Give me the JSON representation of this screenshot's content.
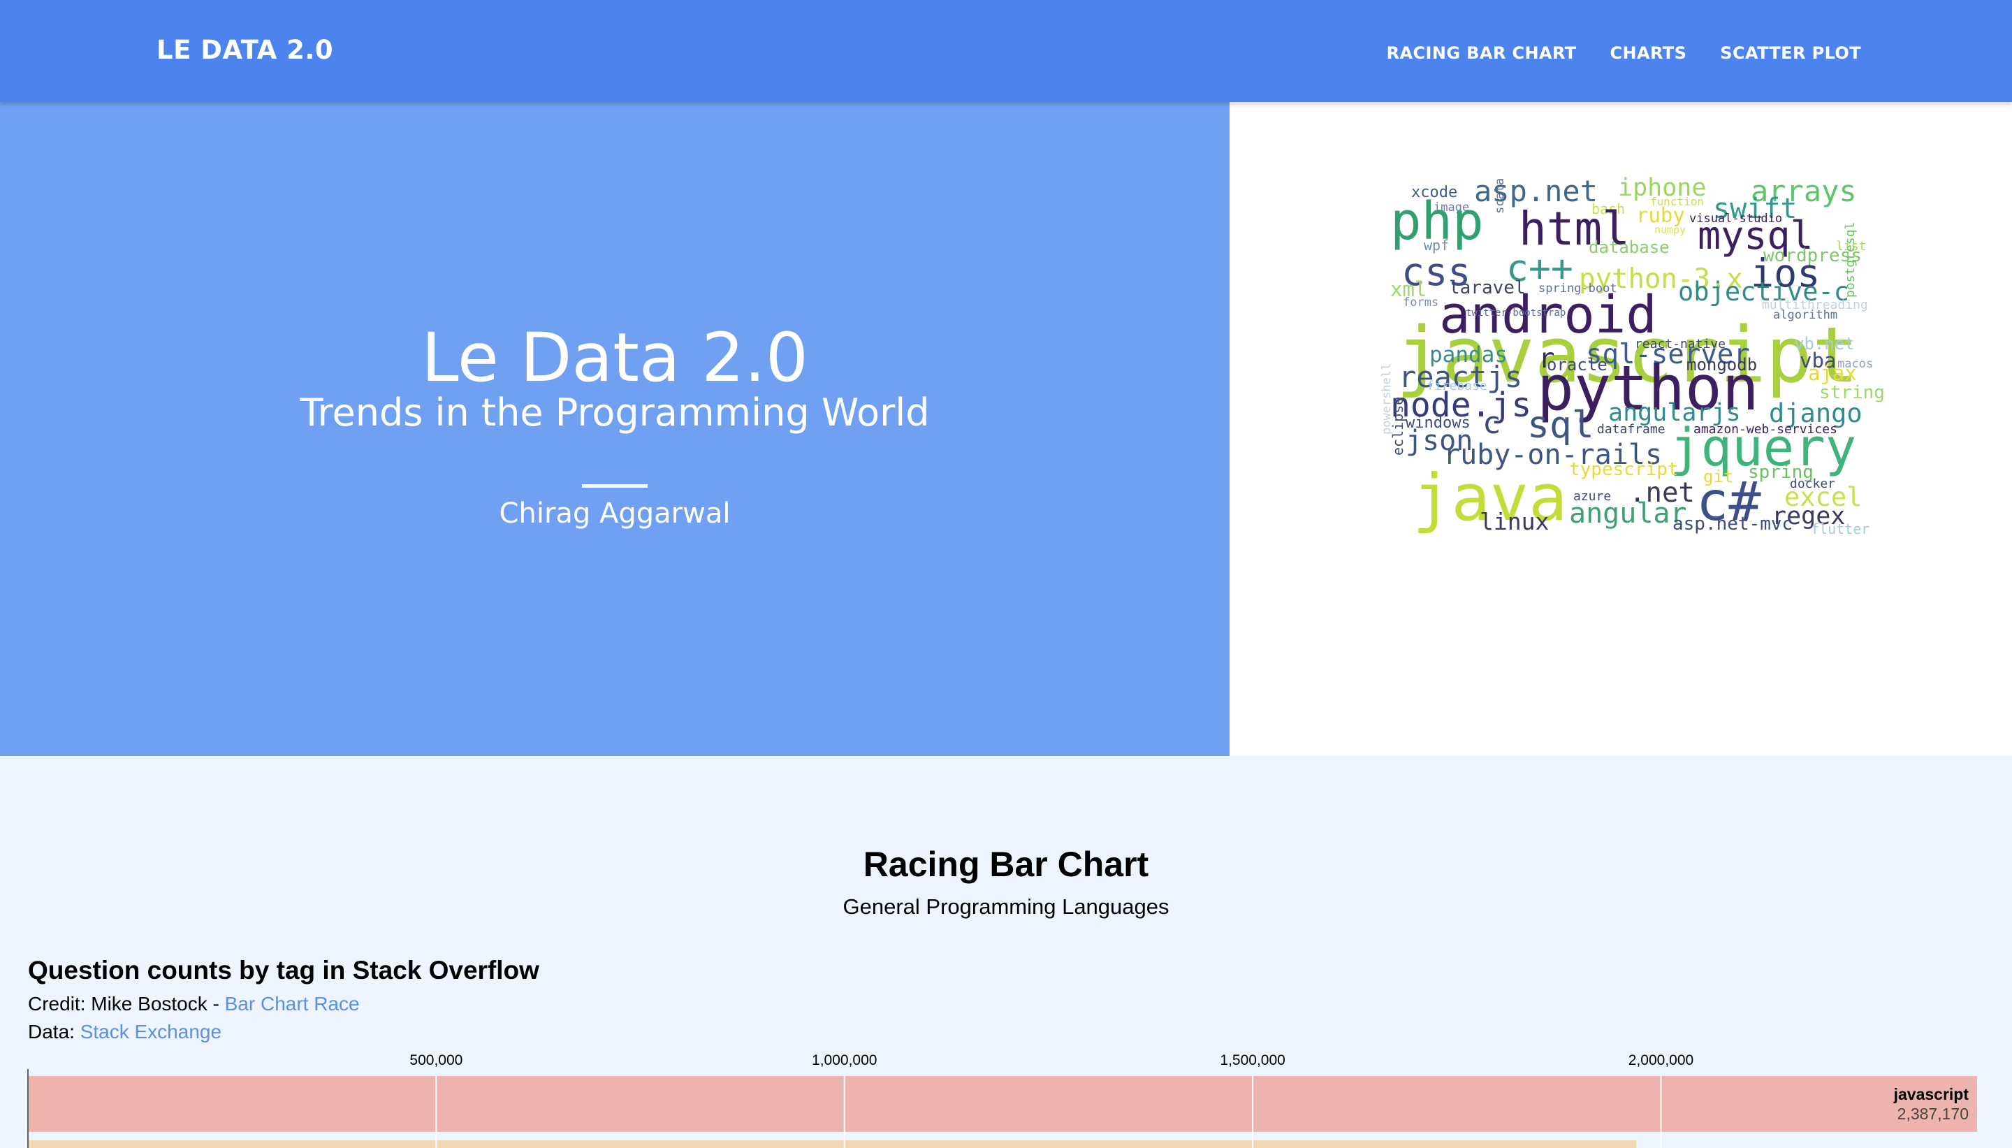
{
  "nav": {
    "brand": "LE DATA 2.0",
    "links": [
      "RACING BAR CHART",
      "CHARTS",
      "SCATTER PLOT"
    ]
  },
  "hero": {
    "title": "Le Data 2.0",
    "subtitle": "Trends in the Programming World",
    "author": "Chirag Aggarwal"
  },
  "wordcloud": {
    "words": [
      {
        "text": "xcode",
        "x": 106,
        "y": 130,
        "size": 24,
        "color": "#3c5b8f",
        "rotate": 0
      },
      {
        "text": "asp.net",
        "x": 153,
        "y": 140,
        "size": 46,
        "color": "#3e698d",
        "rotate": 0
      },
      {
        "text": "iphone",
        "x": 268,
        "y": 133,
        "size": 38,
        "color": "#9ad65e",
        "rotate": 0
      },
      {
        "text": "arrays",
        "x": 362,
        "y": 138,
        "size": 46,
        "color": "#5ec668",
        "rotate": 0
      },
      {
        "text": "image",
        "x": 150,
        "y": 168,
        "size": 18,
        "color": "#6b7fa8",
        "rotate": 0
      },
      {
        "text": "bash",
        "x": 244,
        "y": 168,
        "size": 22,
        "color": "#c8e14a",
        "rotate": 0
      },
      {
        "text": "function",
        "x": 290,
        "y": 160,
        "size": 17,
        "color": "#c8e14a",
        "rotate": 0
      },
      {
        "text": "swift",
        "x": 340,
        "y": 176,
        "size": 44,
        "color": "#2f9a8c",
        "rotate": 0
      },
      {
        "text": "php",
        "x": 88,
        "y": 205,
        "size": 80,
        "color": "#32a06e",
        "rotate": 0
      },
      {
        "text": "html",
        "x": 186,
        "y": 208,
        "size": 72,
        "color": "#3b1f5e",
        "rotate": 0
      },
      {
        "text": "ruby",
        "x": 282,
        "y": 185,
        "size": 32,
        "color": "#e6d93a",
        "rotate": 0
      },
      {
        "text": "visual-studio",
        "x": 322,
        "y": 187,
        "size": 18,
        "color": "#3b1f5e",
        "rotate": 0
      },
      {
        "text": "scala",
        "x": 175,
        "y": 188,
        "size": 18,
        "color": "#5e6d9b",
        "rotate": 90
      },
      {
        "text": "mysql",
        "x": 326,
        "y": 210,
        "size": 60,
        "color": "#3b1f5e",
        "rotate": 0
      },
      {
        "text": "list",
        "x": 424,
        "y": 200,
        "size": 20,
        "color": "#a1db54",
        "rotate": 0
      },
      {
        "text": "numpy",
        "x": 285,
        "y": 203,
        "size": 16,
        "color": "#e0e14e",
        "rotate": 0
      },
      {
        "text": "wpf",
        "x": 116,
        "y": 216,
        "size": 22,
        "color": "#6b8fb0",
        "rotate": 0
      },
      {
        "text": "database",
        "x": 242,
        "y": 218,
        "size": 26,
        "color": "#8dcb6a",
        "rotate": 0
      },
      {
        "text": "c++",
        "x": 180,
        "y": 240,
        "size": 58,
        "color": "#36988a",
        "rotate": 0
      },
      {
        "text": "wordpress",
        "x": 380,
        "y": 228,
        "size": 28,
        "color": "#7fc66a",
        "rotate": 0
      },
      {
        "text": "css",
        "x": 96,
        "y": 245,
        "size": 60,
        "color": "#3e4f88",
        "rotate": 0
      },
      {
        "text": "python-3.x",
        "x": 238,
        "y": 248,
        "size": 42,
        "color": "#c6dd4a",
        "rotate": 0
      },
      {
        "text": "ios",
        "x": 370,
        "y": 258,
        "size": 60,
        "color": "#2e3a6e",
        "rotate": 0
      },
      {
        "text": "xml",
        "x": 88,
        "y": 262,
        "size": 32,
        "color": "#a0d964",
        "rotate": 0
      },
      {
        "text": "laravel",
        "x": 135,
        "y": 258,
        "size": 28,
        "color": "#3e4565",
        "rotate": 0
      },
      {
        "text": "spring-boot",
        "x": 203,
        "y": 258,
        "size": 18,
        "color": "#5e6d9b",
        "rotate": 0
      },
      {
        "text": "forms",
        "x": 97,
        "y": 272,
        "size": 18,
        "color": "#7c8db8",
        "rotate": 0
      },
      {
        "text": "android",
        "x": 125,
        "y": 292,
        "size": 80,
        "color": "#3b1f5e",
        "rotate": 0
      },
      {
        "text": "objective-c",
        "x": 314,
        "y": 276,
        "size": 40,
        "color": "#2f8c8a",
        "rotate": 0
      },
      {
        "text": "multithreading",
        "x": 362,
        "y": 290,
        "size": 20,
        "color": "#c4cfdd",
        "rotate": 0
      },
      {
        "text": "twitter-bootstrap",
        "x": 146,
        "y": 298,
        "size": 15,
        "color": "#5e6d9b",
        "rotate": 0
      },
      {
        "text": "algorithm",
        "x": 362,
        "y": 304,
        "size": 18,
        "color": "#5e6d9b",
        "rotate": 0
      },
      {
        "text": "javascript",
        "x": 92,
        "y": 388,
        "size": 120,
        "color": "#a7cf3e",
        "rotate": 0
      },
      {
        "text": "postgresql",
        "x": 444,
        "y": 292,
        "size": 20,
        "color": "#6bc15e",
        "rotate": 90
      },
      {
        "text": "react-native",
        "x": 280,
        "y": 342,
        "size": 20,
        "color": "#3b4565",
        "rotate": 0
      },
      {
        "text": "vb.net",
        "x": 384,
        "y": 346,
        "size": 26,
        "color": "#a4cbe6",
        "rotate": 0
      },
      {
        "text": "pandas",
        "x": 121,
        "y": 358,
        "size": 34,
        "color": "#398b8a",
        "rotate": 0
      },
      {
        "text": "r",
        "x": 205,
        "y": 370,
        "size": 42,
        "color": "#2e2b5e",
        "rotate": 0
      },
      {
        "text": "sql-server",
        "x": 240,
        "y": 362,
        "size": 42,
        "color": "#3c5b8f",
        "rotate": 0
      },
      {
        "text": "vba",
        "x": 385,
        "y": 370,
        "size": 32,
        "color": "#3e4a78",
        "rotate": 0
      },
      {
        "text": "macos",
        "x": 414,
        "y": 372,
        "size": 18,
        "color": "#8fa0c0",
        "rotate": 0
      },
      {
        "text": "mongodb",
        "x": 320,
        "y": 378,
        "size": 26,
        "color": "#3b3a5e",
        "rotate": 0
      },
      {
        "text": "reactjs",
        "x": 96,
        "y": 392,
        "size": 46,
        "color": "#3e5580",
        "rotate": 0
      },
      {
        "text": "oracle",
        "x": 210,
        "y": 386,
        "size": 26,
        "color": "#3e4a78",
        "rotate": 0
      },
      {
        "text": "python",
        "x": 205,
        "y": 420,
        "size": 96,
        "color": "#3b1f5e",
        "rotate": 0
      },
      {
        "text": "ajax",
        "x": 394,
        "y": 396,
        "size": 32,
        "color": "#e6d93a",
        "rotate": 0
      },
      {
        "text": "firebase",
        "x": 116,
        "y": 402,
        "size": 20,
        "color": "#a4cbe6",
        "rotate": 0
      },
      {
        "text": "string",
        "x": 398,
        "y": 418,
        "size": 28,
        "color": "#a0d964",
        "rotate": 0
      },
      {
        "text": "node.js",
        "x": 90,
        "y": 432,
        "size": 52,
        "color": "#353a7a",
        "rotate": 0
      },
      {
        "text": "windows",
        "x": 103,
        "y": 450,
        "size": 24,
        "color": "#3e4a78",
        "rotate": 0
      },
      {
        "text": "angularjs",
        "x": 263,
        "y": 440,
        "size": 38,
        "color": "#2f8c8a",
        "rotate": 0
      },
      {
        "text": "django",
        "x": 384,
        "y": 440,
        "size": 40,
        "color": "#2f8c8a",
        "rotate": 0
      },
      {
        "text": "c",
        "x": 158,
        "y": 464,
        "size": 48,
        "color": "#3e4a78",
        "rotate": 0
      },
      {
        "text": "sql",
        "x": 194,
        "y": 474,
        "size": 58,
        "color": "#3e5580",
        "rotate": 0
      },
      {
        "text": "dataframe",
        "x": 250,
        "y": 466,
        "size": 20,
        "color": "#3e4565",
        "rotate": 0
      },
      {
        "text": "amazon-web-services",
        "x": 324,
        "y": 462,
        "size": 20,
        "color": "#3b1f5e",
        "rotate": 0
      },
      {
        "text": "powershell",
        "x": 1090,
        "y": 0,
        "size": 18,
        "color": "#c4cfdd",
        "rotate": 90,
        "note": ""
      },
      {
        "text": "json",
        "x": 100,
        "y": 486,
        "size": 44,
        "color": "#3e5580",
        "rotate": 0
      },
      {
        "text": "jquery",
        "x": 308,
        "y": 508,
        "size": 80,
        "color": "#3fb37a",
        "rotate": 0
      },
      {
        "text": "ruby-on-rails",
        "x": 130,
        "y": 510,
        "size": 44,
        "color": "#3e5580",
        "rotate": 0
      },
      {
        "text": "typescript",
        "x": 228,
        "y": 526,
        "size": 28,
        "color": "#e6d93a",
        "rotate": 0
      },
      {
        "text": "spring",
        "x": 364,
        "y": 528,
        "size": 28,
        "color": "#6bc15e",
        "rotate": 0
      },
      {
        "text": "git",
        "x": 334,
        "y": 534,
        "size": 26,
        "color": "#e6d93a",
        "rotate": 0
      },
      {
        "text": "docker",
        "x": 393,
        "y": 548,
        "size": 20,
        "color": "#3e4a78",
        "rotate": 0
      },
      {
        "text": "java",
        "x": 108,
        "y": 588,
        "size": 100,
        "color": "#c4db3a",
        "rotate": 0
      },
      {
        "text": "eclipse",
        "x": 96,
        "y": 490,
        "size": 22,
        "color": "#3e4a78",
        "rotate": 90
      },
      {
        "text": ".net",
        "x": 276,
        "y": 564,
        "size": 42,
        "color": "#3b3a5e",
        "rotate": 0
      },
      {
        "text": "c#",
        "x": 326,
        "y": 590,
        "size": 84,
        "color": "#3e4f88",
        "rotate": 0
      },
      {
        "text": "excel",
        "x": 393,
        "y": 566,
        "size": 40,
        "color": "#c8e14a",
        "rotate": 0
      },
      {
        "text": "azure",
        "x": 232,
        "y": 568,
        "size": 20,
        "color": "#3e4a78",
        "rotate": 0
      },
      {
        "text": "regex",
        "x": 384,
        "y": 596,
        "size": 38,
        "color": "#3b3a5e",
        "rotate": 0
      },
      {
        "text": "angular",
        "x": 228,
        "y": 594,
        "size": 44,
        "color": "#3fa070",
        "rotate": 0
      },
      {
        "text": "linux",
        "x": 158,
        "y": 604,
        "size": 36,
        "color": "#3b3a5e",
        "rotate": 0
      },
      {
        "text": "asp.net-mvc",
        "x": 310,
        "y": 606,
        "size": 28,
        "color": "#3e4a78",
        "rotate": 0
      },
      {
        "text": "flutter",
        "x": 410,
        "y": 608,
        "size": 22,
        "color": "#a4cbe6",
        "rotate": 0
      }
    ]
  },
  "section": {
    "title": "Racing Bar Chart",
    "subtitle": "General Programming Languages"
  },
  "race": {
    "heading": "Question counts by tag in Stack Overflow",
    "credit_prefix": "Credit: Mike Bostock - ",
    "credit_link": "Bar Chart Race",
    "data_prefix": "Data: ",
    "data_link": "Stack Exchange"
  },
  "chart_data": {
    "type": "bar",
    "title": "Question counts by tag in Stack Overflow",
    "ticks": [
      500000,
      1000000,
      1500000,
      2000000
    ],
    "tick_labels": [
      "500,000",
      "1,000,000",
      "1,500,000",
      "2,000,000"
    ],
    "series": [
      {
        "name": "javascript",
        "value": 2387170,
        "value_label": "2,387,170",
        "color": "#edb4ae"
      },
      {
        "name": "",
        "value": 1970000,
        "color": "#f2d8b1"
      }
    ],
    "xlim": [
      0,
      2387170
    ]
  }
}
